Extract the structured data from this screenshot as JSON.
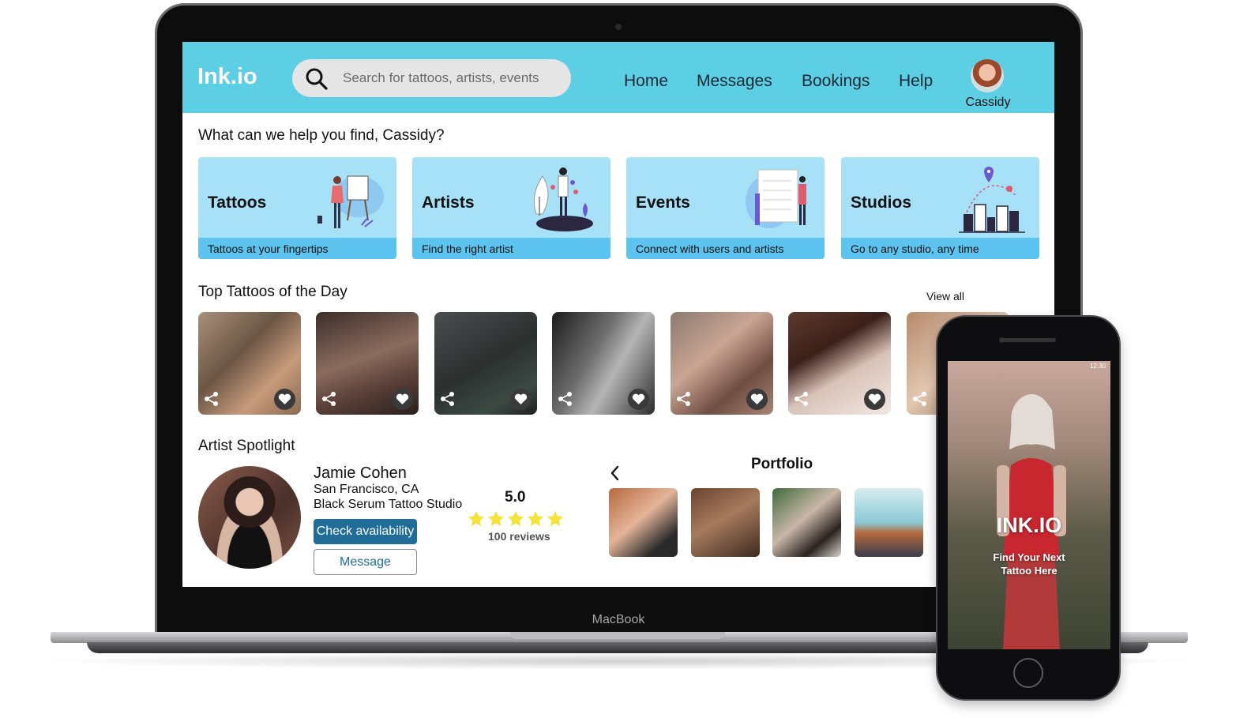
{
  "app": {
    "logo": "Ink.io",
    "search_placeholder": "Search for tattoos, artists, events",
    "nav": [
      "Home",
      "Messages",
      "Bookings",
      "Help"
    ],
    "user_name": "Cassidy"
  },
  "greeting": "What can we help you find, Cassidy?",
  "categories": [
    {
      "title": "Tattoos",
      "subtitle": "Tattoos at your fingertips"
    },
    {
      "title": "Artists",
      "subtitle": "Find the right artist"
    },
    {
      "title": "Events",
      "subtitle": "Connect with users and artists"
    },
    {
      "title": "Studios",
      "subtitle": "Go to any studio, any time"
    }
  ],
  "top_tattoos": {
    "title": "Top Tattoos of the Day",
    "view_all": "View all",
    "tile_count_visible": 7
  },
  "artist_spotlight": {
    "title": "Artist Spotlight",
    "name": "Jamie Cohen",
    "location": "San Francisco, CA",
    "studio": "Black Serum Tattoo Studio",
    "check_availability": "Check availability",
    "message": "Message",
    "rating": "5.0",
    "stars": 5,
    "reviews": "100 reviews",
    "portfolio_title": "Portfolio"
  },
  "device": {
    "laptop_label": "MacBook",
    "phone_brand": "INK.IO",
    "phone_tagline_1": "Find Your Next",
    "phone_tagline_2": "Tattoo Here",
    "phone_time": "12:30"
  },
  "colors": {
    "topbar": "#5dcfe4",
    "card_bg": "#a6e1f7",
    "card_strip": "#5cc4ef",
    "primary_button": "#206d9a",
    "star": "#f5e23c"
  }
}
